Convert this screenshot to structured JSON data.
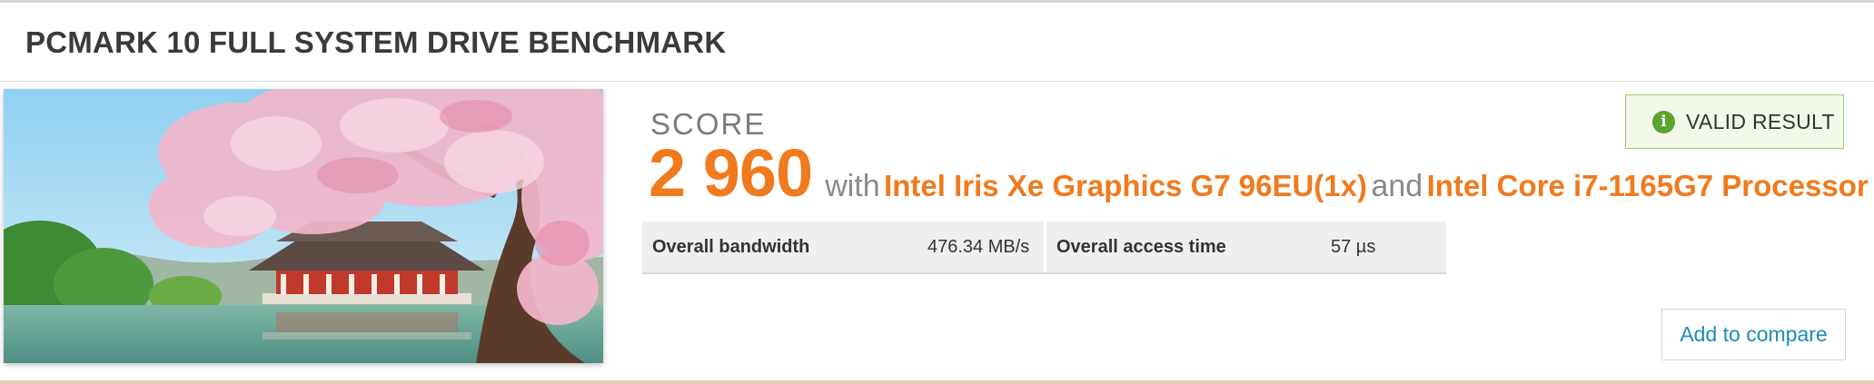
{
  "header": {
    "title": "PCMARK 10 FULL SYSTEM DRIVE BENCHMARK"
  },
  "score": {
    "label": "SCORE",
    "value": "2 960",
    "with_text": "with",
    "gpu": "Intel Iris Xe Graphics G7 96EU(1x)",
    "and_text": "and",
    "cpu": "Intel Core i7-1165G7 Processor"
  },
  "metrics": [
    {
      "label": "Overall bandwidth",
      "value": "476.34 MB/s"
    },
    {
      "label": "Overall access time",
      "value": "57 µs"
    }
  ],
  "badge": {
    "icon": "info-icon",
    "glyph": "i",
    "text": "VALID RESULT"
  },
  "actions": {
    "compare_label": "Add to compare"
  },
  "illustration": {
    "subject": "cherry-blossom-pavilion"
  },
  "colors": {
    "accent": "#f07a1e",
    "link": "#1e8bb8",
    "valid_green": "#5aa52c"
  }
}
